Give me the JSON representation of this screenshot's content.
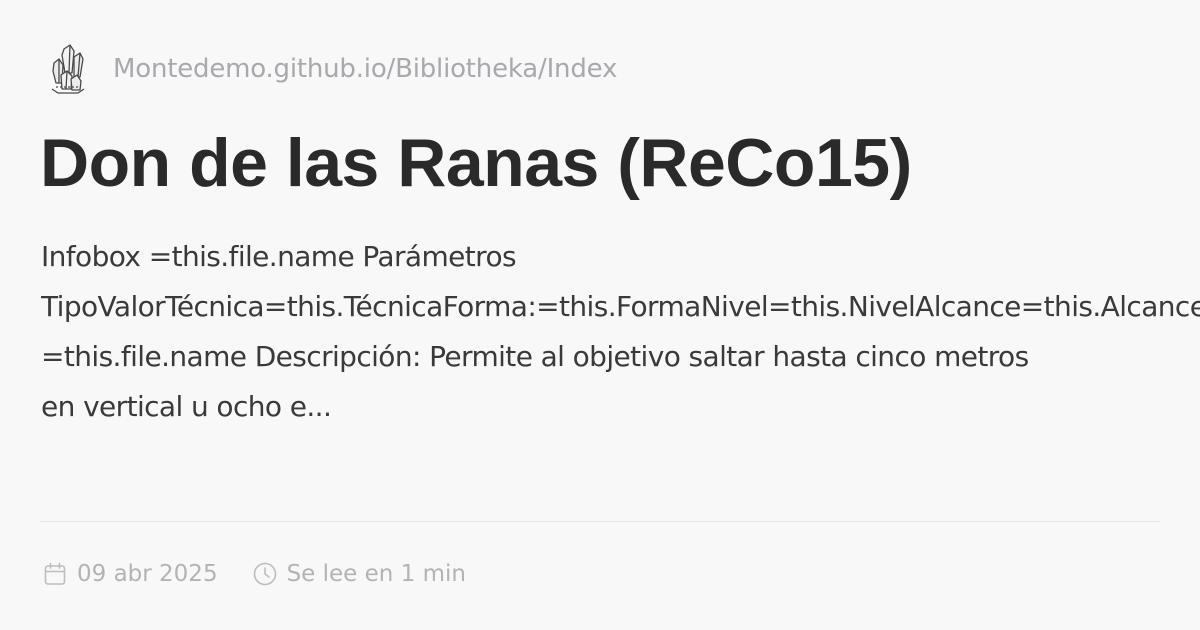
{
  "site": {
    "url": "Montedemo.github.io/Bibliotheka/Index",
    "logo_icon": "crystal-cluster-icon"
  },
  "page": {
    "title": "Don de las Ranas (ReCo15)",
    "description_lines": [
      "Infobox =this.file.name Parámetros",
      "TipoValorTécnica=this.TécnicaForma:=this.FormaNivel=this.NivelAlcance=this.Alcance",
      "=this.file.name Descripción: Permite al objetivo saltar hasta cinco metros",
      "en vertical u ocho e..."
    ]
  },
  "meta": {
    "date": "09 abr 2025",
    "date_icon": "calendar-icon",
    "reading_time": "Se lee en 1 min",
    "reading_time_icon": "clock-icon"
  },
  "colors": {
    "background": "#f8f8f9",
    "title": "#2a2a2a",
    "muted": "#a9a9ad"
  }
}
